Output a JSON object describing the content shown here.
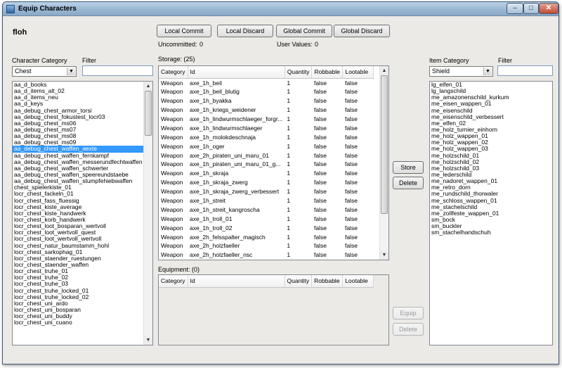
{
  "window": {
    "title": "Equip Characters",
    "controls": {
      "minimize": "–",
      "maximize": "□",
      "close": "✕"
    }
  },
  "user": "floh",
  "commit_buttons": {
    "local_commit": "Local Commit",
    "local_discard": "Local Discard",
    "global_commit": "Global Commit",
    "global_discard": "Global Discard"
  },
  "status": {
    "uncommitted_label": "Uncommitted:",
    "uncommitted_value": "0",
    "user_values_label": "User Values:",
    "user_values_value": "0"
  },
  "left_panel": {
    "category_label": "Character Category",
    "category_value": "Chest",
    "filter_label": "Filter",
    "filter_value": "",
    "items": [
      "aa_d_books",
      "aa_d_items_alt_02",
      "aa_d_items_neu",
      "aa_d_keys",
      "aa_debug_chest_armor_torsi",
      "aa_debug_chest_fokustest_locr03",
      "aa_debug_chest_ms06",
      "aa_debug_chest_ms07",
      "aa_debug_chest_ms08",
      "aa_debug_chest_ms09",
      "aa_debug_chest_waffen_aexte",
      "aa_debug_chest_waffen_fernkampf",
      "aa_debug_chest_waffen_messerundfechtwaffen",
      "aa_debug_chest_waffen_schwerter",
      "aa_debug_chest_waffen_speereundstaebe",
      "aa_debug_chest_waffen_stumpfehiebwaffen",
      "chest_spielerkiste_01",
      "locr_chest_fackeln_01",
      "locr_chest_fass_fluessig",
      "locr_chest_kiste_average",
      "locr_chest_kiste_handwerk",
      "locr_chest_korb_handwerk",
      "locr_chest_loot_bosparan_wertvoll",
      "locr_chest_loot_wertvoll_quest",
      "locr_chest_loot_wertvoll_wertvoll",
      "locr_chest_natur_baumstamm_hohl",
      "locr_chest_sarkophag_01",
      "locr_chest_staender_ruestungen",
      "locr_chest_staender_waffen",
      "locr_chest_truhe_01",
      "locr_chest_truhe_02",
      "locr_chest_truhe_03",
      "locr_chest_truhe_locked_01",
      "locr_chest_truhe_locked_02",
      "locr_chest_uni_ardo",
      "locr_chest_uni_bosparan",
      "locr_chest_uni_buddy",
      "locr_chest_uni_cuano"
    ],
    "selected_item": "aa_debug_chest_waffen_aexte"
  },
  "storage": {
    "label": "Storage: (25)",
    "columns": [
      "Category",
      "Id",
      "Quantity",
      "Robbable",
      "Lootable"
    ],
    "rows": [
      [
        "Weapon",
        "axe_1h_beil",
        "1",
        "false",
        "false"
      ],
      [
        "Weapon",
        "axe_1h_beil_blutig",
        "1",
        "false",
        "false"
      ],
      [
        "Weapon",
        "axe_1h_byakka",
        "1",
        "false",
        "false"
      ],
      [
        "Weapon",
        "axe_1h_kriegs_weidener",
        "1",
        "false",
        "false"
      ],
      [
        "Weapon",
        "axe_1h_lindwurmschlaeger_forgr...",
        "1",
        "false",
        "false"
      ],
      [
        "Weapon",
        "axe_1h_lindwurmschlaeger",
        "1",
        "false",
        "false"
      ],
      [
        "Weapon",
        "axe_1h_molokdeschnaja",
        "1",
        "false",
        "false"
      ],
      [
        "Weapon",
        "axe_1h_oger",
        "1",
        "false",
        "false"
      ],
      [
        "Weapon",
        "axe_2h_piraten_uni_maru_01",
        "1",
        "false",
        "false"
      ],
      [
        "Weapon",
        "axe_1h_piraten_uni_maru_01_g...",
        "1",
        "false",
        "false"
      ],
      [
        "Weapon",
        "axe_1h_skraja",
        "1",
        "false",
        "false"
      ],
      [
        "Weapon",
        "axe_1h_skraja_zwerg",
        "1",
        "false",
        "false"
      ],
      [
        "Weapon",
        "axe_1h_skraja_zwerg_verbessert",
        "1",
        "false",
        "false"
      ],
      [
        "Weapon",
        "axe_1h_streit",
        "1",
        "false",
        "false"
      ],
      [
        "Weapon",
        "axe_1h_streit_kangroscha",
        "1",
        "false",
        "false"
      ],
      [
        "Weapon",
        "axe_1h_troll_01",
        "1",
        "false",
        "false"
      ],
      [
        "Weapon",
        "axe_1h_troll_02",
        "1",
        "false",
        "false"
      ],
      [
        "Weapon",
        "axe_2h_felsspalter_magisch",
        "1",
        "false",
        "false"
      ],
      [
        "Weapon",
        "axe_2h_holzfaeller",
        "1",
        "false",
        "false"
      ],
      [
        "Weapon",
        "axe_2h_holzfaeller_nsc",
        "1",
        "false",
        "false"
      ]
    ]
  },
  "equipment": {
    "label": "Equipment: (0)",
    "columns": [
      "Category",
      "Id",
      "Quantity",
      "Robbable",
      "Lootable"
    ]
  },
  "middle_buttons": {
    "store": "Store",
    "delete": "Delete",
    "equip": "Equip",
    "delete2": "Delete"
  },
  "right_panel": {
    "category_label": "Item Category",
    "category_value": "Shield",
    "filter_label": "Filter",
    "filter_value": "",
    "items": [
      "lg_elfen_01",
      "lg_langschild",
      "me_amazonenschild_kurkum",
      "me_eisen_wappen_01",
      "me_eisenschild",
      "me_eisenschild_verbessert",
      "me_elfen_02",
      "me_holz_turnier_einhorn",
      "me_holz_wappen_01",
      "me_holz_wappen_02",
      "me_holz_wappen_03",
      "me_holzschild_01",
      "me_holzschild_02",
      "me_holzschild_03",
      "me_lederschild",
      "me_nadoret_wappen_01",
      "me_retro_dorn",
      "me_rundschild_thorwaler",
      "me_schloss_wappen_01",
      "me_stachelschild",
      "me_zollfeste_wappen_01",
      "sm_bock",
      "sm_buckler",
      "sm_stachelhandschuh"
    ]
  }
}
